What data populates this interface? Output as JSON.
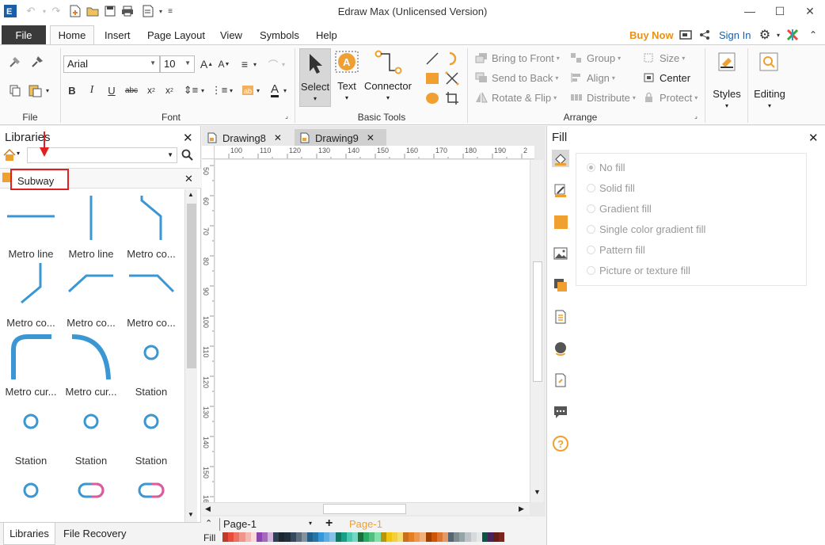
{
  "app": {
    "title": "Edraw Max (Unlicensed Version)"
  },
  "menu": {
    "file": "File",
    "tabs": [
      "Home",
      "Insert",
      "Page Layout",
      "View",
      "Symbols",
      "Help"
    ],
    "buy_now": "Buy Now",
    "sign_in": "Sign In"
  },
  "ribbon": {
    "file_group": "File",
    "font_group": "Font",
    "font_name": "Arial",
    "font_size": "10",
    "basic_tools_group": "Basic Tools",
    "select": "Select",
    "text": "Text",
    "connector": "Connector",
    "arrange_group": "Arrange",
    "bring_to_front": "Bring to Front",
    "send_to_back": "Send to Back",
    "rotate_flip": "Rotate & Flip",
    "group": "Group",
    "align": "Align",
    "distribute": "Distribute",
    "size": "Size",
    "center": "Center",
    "protect": "Protect",
    "styles": "Styles",
    "editing": "Editing",
    "accent_color": "#f0a030"
  },
  "libraries": {
    "title": "Libraries",
    "search_value": "",
    "library_name": "Subway",
    "items": [
      {
        "label": "Metro line"
      },
      {
        "label": "Metro line"
      },
      {
        "label": "Metro co..."
      },
      {
        "label": "Metro co..."
      },
      {
        "label": "Metro co..."
      },
      {
        "label": "Metro co..."
      },
      {
        "label": "Metro cur..."
      },
      {
        "label": "Metro cur..."
      },
      {
        "label": "Station"
      },
      {
        "label": "Station"
      },
      {
        "label": "Station"
      },
      {
        "label": "Station"
      }
    ],
    "bottom_tabs": [
      "Libraries",
      "File Recovery"
    ],
    "shape_color": "#3b97d3"
  },
  "documents": {
    "tabs": [
      "Drawing8",
      "Drawing9"
    ],
    "ruler_top": [
      "100",
      "110",
      "120",
      "130",
      "140",
      "150",
      "160",
      "170",
      "180",
      "190",
      "2"
    ],
    "ruler_left": [
      "50",
      "60",
      "70",
      "80",
      "90",
      "100",
      "110",
      "120",
      "130",
      "140",
      "150",
      "16"
    ]
  },
  "status": {
    "page_select": "Page-1",
    "page_tab": "Page-1",
    "fill_label": "Fill"
  },
  "fill": {
    "title": "Fill",
    "options": [
      "No fill",
      "Solid fill",
      "Gradient fill",
      "Single color gradient fill",
      "Pattern fill",
      "Picture or texture fill"
    ]
  }
}
